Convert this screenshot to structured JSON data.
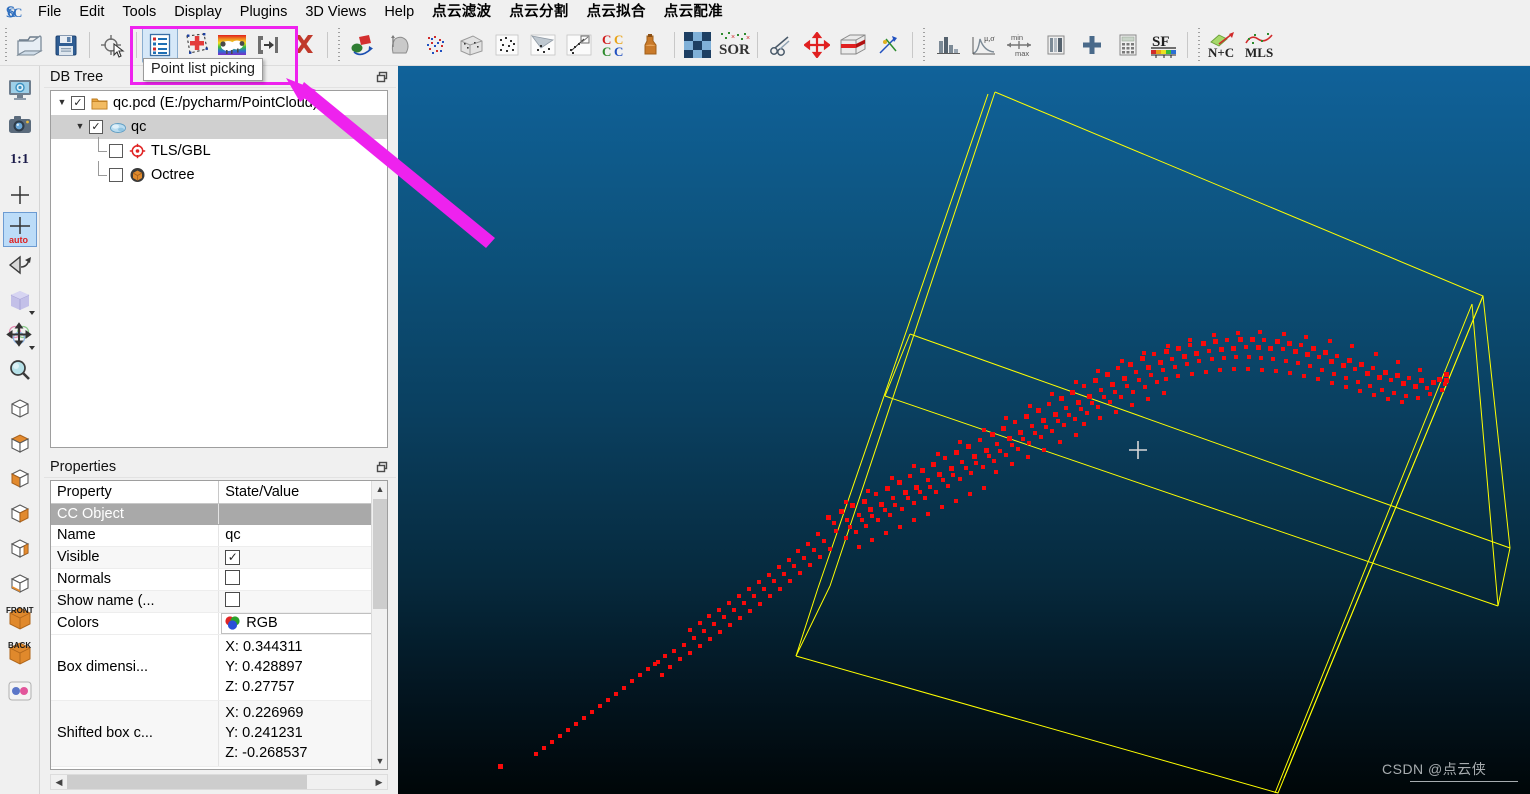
{
  "app": {
    "title": "CloudCompare",
    "logo_text": "CC"
  },
  "menubar": {
    "items": [
      {
        "label": "File",
        "cjk": false
      },
      {
        "label": "Edit",
        "cjk": false
      },
      {
        "label": "Tools",
        "cjk": false
      },
      {
        "label": "Display",
        "cjk": false
      },
      {
        "label": "Plugins",
        "cjk": false
      },
      {
        "label": "3D Views",
        "cjk": false
      },
      {
        "label": "Help",
        "cjk": false
      },
      {
        "label": "点云滤波",
        "cjk": true
      },
      {
        "label": "点云分割",
        "cjk": true
      },
      {
        "label": "点云拟合",
        "cjk": true
      },
      {
        "label": "点云配准",
        "cjk": true
      }
    ]
  },
  "toolbar": {
    "groups": [
      {
        "icons": [
          "open-folder-icon",
          "save-disk-icon"
        ]
      },
      {
        "icons": [
          "pick-rotation-center-icon"
        ]
      },
      {
        "icons": [
          "point-list-picking-icon",
          "point-picking-icon",
          "rainbow-sheep-icon",
          "export-segment-icon",
          "delete-cross-icon"
        ]
      },
      {
        "icons": [
          "apply-transformation-icon",
          "compute-normals-icon",
          "scalar-field-points-icon",
          "mesh-sample-icon",
          "cloud-compare-icon",
          "cloud-mesh-dist-icon",
          "cloud-registration-icon",
          "cc-colors-icon",
          "glue-icon"
        ]
      },
      {
        "icons": [
          "subsample-checker-icon",
          "sor-filter-icon"
        ]
      },
      {
        "icons": [
          "scissors-icon",
          "translate-rotate-icon",
          "cross-section-icon",
          "normals-flip-icon"
        ]
      },
      {
        "icons": [
          "histogram-icon",
          "gauss-filter-icon",
          "min-max-icon",
          "color-scale-icon",
          "plus-icon",
          "calculator-icon",
          "sf-scalar-field-icon"
        ]
      },
      {
        "icons": [
          "n-plus-c-icon",
          "mls-icon"
        ]
      }
    ],
    "tooltip": "Point list picking",
    "highlight_color": "#ee22ee"
  },
  "left_toolbar": {
    "items": [
      {
        "name": "display-settings-icon",
        "selected": false
      },
      {
        "name": "camera-snapshot-icon",
        "selected": false
      },
      {
        "name": "zoom-1-1-icon",
        "label": "1:1",
        "selected": false
      },
      {
        "name": "set-pivot-icon",
        "selected": false
      },
      {
        "name": "auto-pivot-icon",
        "label": "auto",
        "selected": true
      },
      {
        "name": "rotate-view-icon",
        "selected": false
      },
      {
        "name": "default-light-cube-icon",
        "selected": false,
        "caret": true
      },
      {
        "name": "move-object-icon",
        "selected": false,
        "caret": true
      },
      {
        "name": "zoom-magnifier-icon",
        "selected": false
      },
      {
        "name": "view-global-icon",
        "selected": false
      },
      {
        "name": "view-top-icon",
        "selected": false
      },
      {
        "name": "view-bottom-icon",
        "selected": false
      },
      {
        "name": "view-left-icon",
        "selected": false
      },
      {
        "name": "view-right-icon",
        "selected": false
      },
      {
        "name": "view-iso-icon",
        "selected": false
      },
      {
        "name": "view-front-icon",
        "label": "FRONT",
        "selected": false
      },
      {
        "name": "view-back-icon",
        "label": "BACK",
        "selected": false
      },
      {
        "name": "stereo-mode-icon",
        "selected": false
      }
    ]
  },
  "db_tree": {
    "title": "DB Tree",
    "float_icon": "restore-window-icon",
    "nodes": [
      {
        "label": "qc.pcd (E:/pycharm/PointCloud)",
        "checked": true,
        "expanded": true,
        "depth": 0,
        "icon": "folder-icon",
        "selected": false
      },
      {
        "label": "qc",
        "checked": true,
        "expanded": true,
        "depth": 1,
        "icon": "point-cloud-icon",
        "selected": true
      },
      {
        "label": "TLS/GBL",
        "checked": false,
        "expanded": null,
        "depth": 2,
        "icon": "sensor-target-icon",
        "selected": false
      },
      {
        "label": "Octree",
        "checked": false,
        "expanded": null,
        "depth": 2,
        "icon": "octree-cube-icon",
        "selected": false
      }
    ]
  },
  "properties": {
    "title": "Properties",
    "float_icon": "restore-window-icon",
    "headers": [
      "Property",
      "State/Value"
    ],
    "rows": [
      {
        "type": "section",
        "label": "CC Object",
        "value": ""
      },
      {
        "type": "text",
        "label": "Name",
        "value": "qc"
      },
      {
        "type": "checkbox",
        "label": "Visible",
        "value": "checked"
      },
      {
        "type": "checkbox",
        "label": "Normals",
        "value": "unchecked"
      },
      {
        "type": "checkbox",
        "label": "Show name (...",
        "value": "unchecked"
      },
      {
        "type": "combo",
        "label": "Colors",
        "value": "RGB",
        "icon": "rgb-colors-icon"
      },
      {
        "type": "xyz",
        "label": "Box dimensi...",
        "x": "X: 0.344311",
        "y": "Y: 0.428897",
        "z": "Z: 0.27757"
      },
      {
        "type": "xyz",
        "label": "Shifted box c...",
        "x": "X: 0.226969",
        "y": "Y: 0.241231",
        "z": "Z: -0.268537"
      }
    ]
  },
  "viewport": {
    "name": "3d-view",
    "background_top": "#10629a",
    "background_bottom": "#000608",
    "bbox_color": "#ffff00",
    "point_color": "#ff0000",
    "cursor_cross_color": "#d8d8d8",
    "watermark": "CSDN @点云侠"
  }
}
